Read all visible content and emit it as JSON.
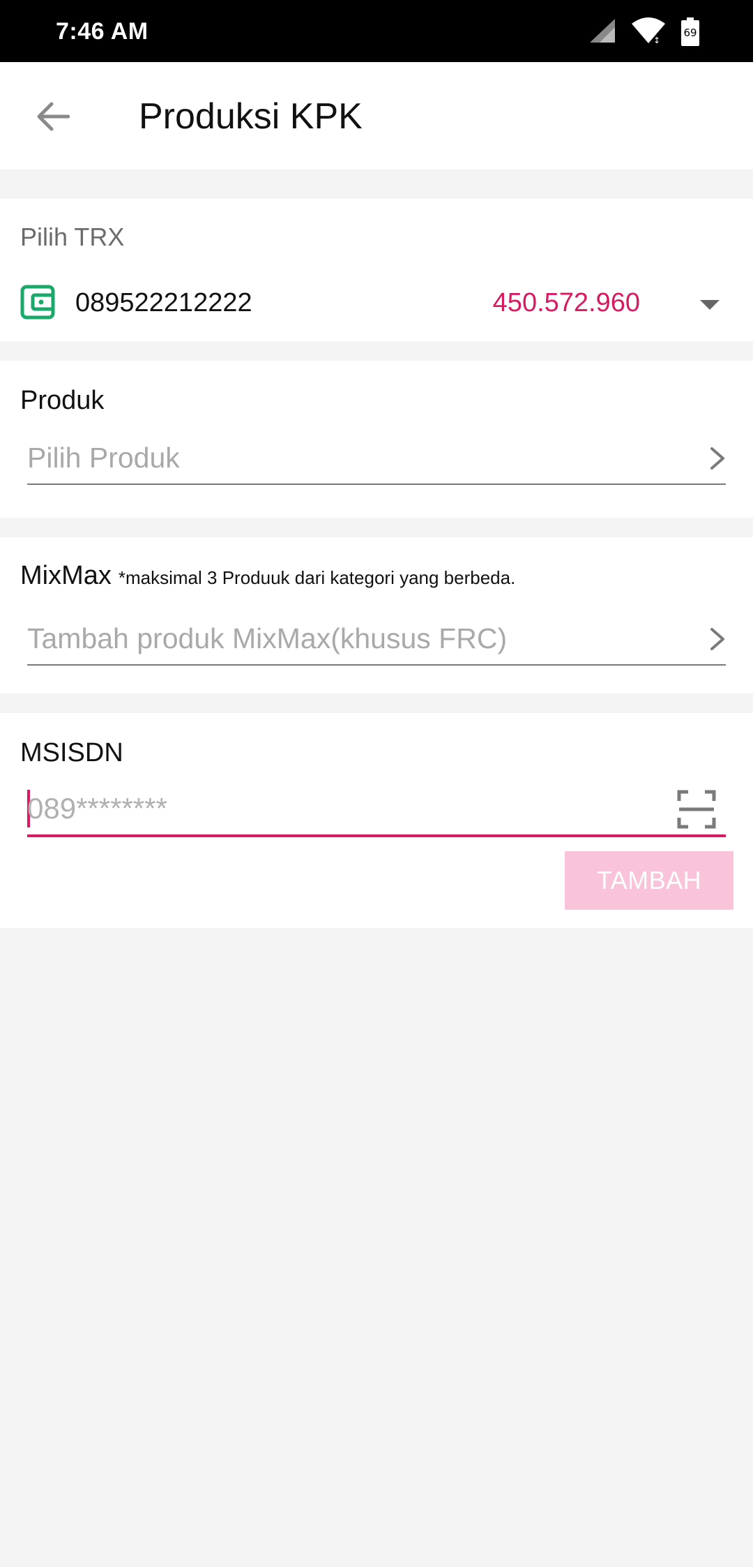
{
  "status_bar": {
    "time": "7:46 AM",
    "battery_level": "69",
    "icons": [
      "signal-icon",
      "wifi-icon",
      "battery-icon"
    ]
  },
  "app_bar": {
    "title": "Produksi KPK",
    "back_icon": "arrow-back-icon"
  },
  "trx": {
    "label": "Pilih TRX",
    "number": "089522212222",
    "balance": "450.572.960",
    "icon": "wallet-icon"
  },
  "produk": {
    "label": "Produk",
    "placeholder": "Pilih Produk"
  },
  "mixmax": {
    "label": "MixMax",
    "note": "*maksimal 3 Produuk dari kategori yang berbeda.",
    "placeholder": "Tambah produk MixMax(khusus FRC)"
  },
  "msisdn": {
    "label": "MSISDN",
    "placeholder": "089********",
    "value": ""
  },
  "actions": {
    "add_label": "TAMBAH"
  },
  "colors": {
    "accent": "#d81b60",
    "button_disabled": "#f9c3d9",
    "wallet_icon": "#1aa96b",
    "background": "#f4f4f4"
  }
}
